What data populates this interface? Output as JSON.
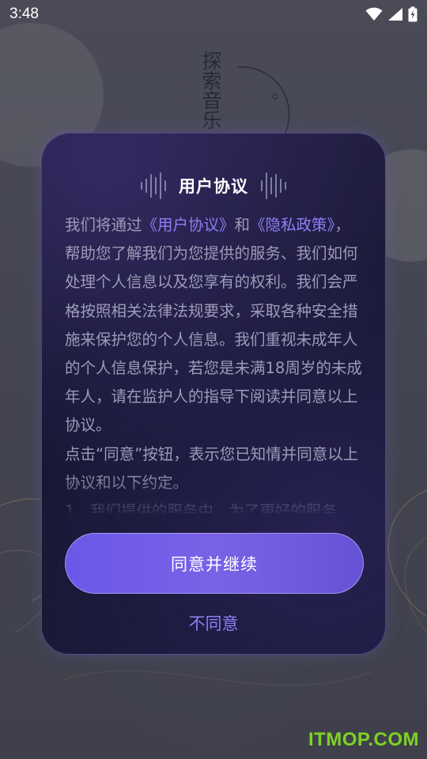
{
  "status_bar": {
    "time": "3:48"
  },
  "background": {
    "vertical_title": "探索音乐"
  },
  "dialog": {
    "title": "用户协议",
    "body": {
      "intro": "我们将通过",
      "link_user_agreement": "《用户协议》",
      "and": "和",
      "link_privacy_policy": "《隐私政策》",
      "paragraph_1_rest": "，帮助您了解我们为您提供的服务、我们如何处理个人信息以及您享有的权利。我们会严格按照相关法律法规要求，采取各种安全措施来保护您的个人信息。我们重视未成年人的个人信息保护，若您是未满18周岁的未成年人，请在监护人的指导下阅读并同意以上协议。",
      "paragraph_2": "点击“同意”按钮，表示您已知情并同意以上协议和以下约定。",
      "paragraph_3_partial": "1、我们提供的服务中，为了更好的服务"
    },
    "agree_label": "同意并继续",
    "disagree_label": "不同意"
  },
  "watermark": "ITMOP.COM",
  "colors": {
    "accent": "#8f7ef5",
    "button_start": "#6a58e8",
    "button_end": "#6652d6",
    "dialog_bg": "#1a1936",
    "watermark": "#7ed321"
  }
}
